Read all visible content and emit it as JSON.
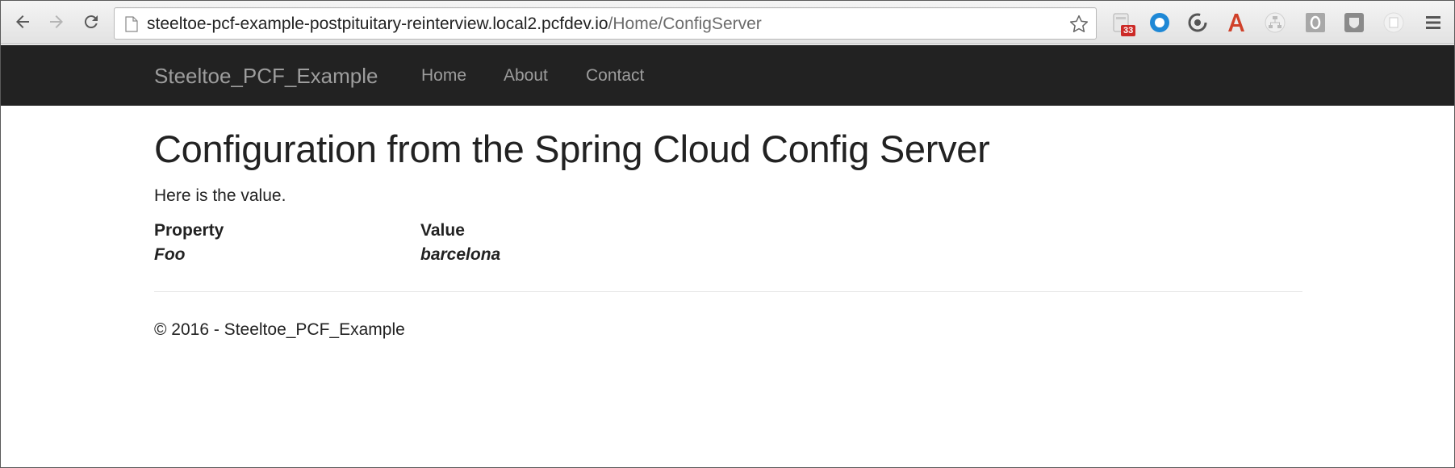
{
  "browser": {
    "url_host": "steeltoe-pcf-example-postpituitary-reinterview.local2.pcfdev.io",
    "url_path": "/Home/ConfigServer",
    "extensions": [
      {
        "name": "calendar-extension-icon",
        "badge": "33"
      },
      {
        "name": "circle-extension-icon"
      },
      {
        "name": "sync-extension-icon"
      },
      {
        "name": "font-extension-icon"
      },
      {
        "name": "sitemap-extension-icon"
      },
      {
        "name": "letter-o-extension-icon"
      },
      {
        "name": "shield-extension-icon"
      },
      {
        "name": "page-extension-icon"
      }
    ]
  },
  "navbar": {
    "brand": "Steeltoe_PCF_Example",
    "links": [
      "Home",
      "About",
      "Contact"
    ]
  },
  "main": {
    "title": "Configuration from the Spring Cloud Config Server",
    "lead": "Here is the value.",
    "table": {
      "headers": [
        "Property",
        "Value"
      ],
      "rows": [
        [
          "Foo",
          "barcelona"
        ]
      ]
    }
  },
  "footer": {
    "text": "© 2016 - Steeltoe_PCF_Example"
  }
}
